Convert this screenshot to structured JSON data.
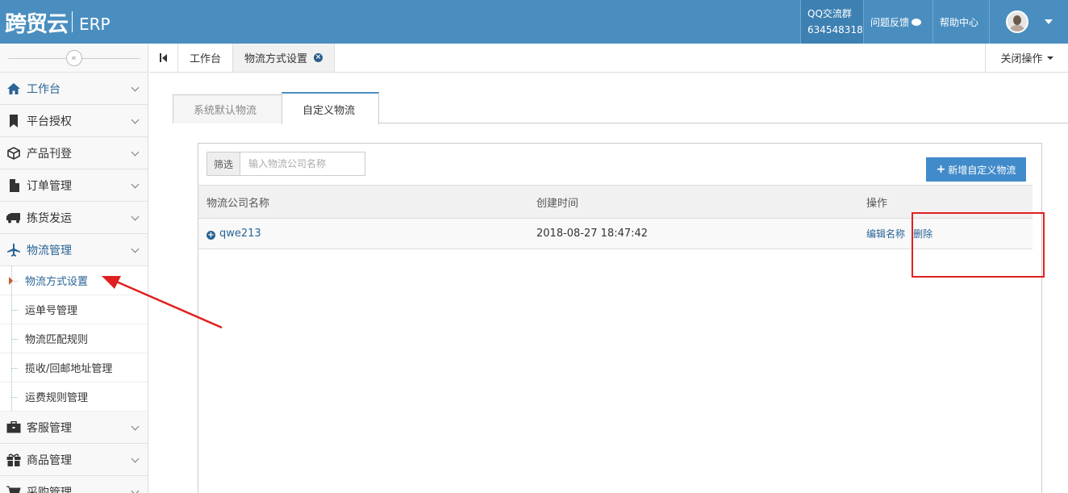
{
  "header": {
    "logo_text": "跨贸云",
    "logo_suffix": "ERP",
    "qq_label": "QQ交流群",
    "qq_number": "634548318",
    "feedback_label": "问题反馈",
    "help_label": "帮助中心"
  },
  "sidebar": {
    "collapse_symbol": "«",
    "items": [
      {
        "label": "工作台"
      },
      {
        "label": "平台授权"
      },
      {
        "label": "产品刊登"
      },
      {
        "label": "订单管理"
      },
      {
        "label": "拣货发运"
      },
      {
        "label": "物流管理"
      },
      {
        "label": "客服管理"
      },
      {
        "label": "商品管理"
      },
      {
        "label": "采购管理"
      }
    ],
    "logistics_sub": [
      {
        "label": "物流方式设置"
      },
      {
        "label": "运单号管理"
      },
      {
        "label": "物流匹配规则"
      },
      {
        "label": "揽收/回邮地址管理"
      },
      {
        "label": "运费规则管理"
      }
    ]
  },
  "tabbar": {
    "tabs": [
      {
        "label": "工作台"
      },
      {
        "label": "物流方式设置"
      }
    ],
    "close_ops": "关闭操作"
  },
  "content": {
    "subtabs": [
      {
        "label": "系统默认物流"
      },
      {
        "label": "自定义物流"
      }
    ],
    "filter_label": "筛选",
    "filter_placeholder": "输入物流公司名称",
    "add_button": "新增自定义物流",
    "table": {
      "headers": [
        "物流公司名称",
        "创建时间",
        "操作"
      ],
      "rows": [
        {
          "name": "qwe213",
          "created": "2018-08-27 18:47:42",
          "edit": "编辑名称",
          "delete": "删除"
        }
      ]
    }
  },
  "colors": {
    "header_bg": "#4a8ec0",
    "primary": "#428bca",
    "link": "#2a6496",
    "annotation": "#e02020"
  }
}
